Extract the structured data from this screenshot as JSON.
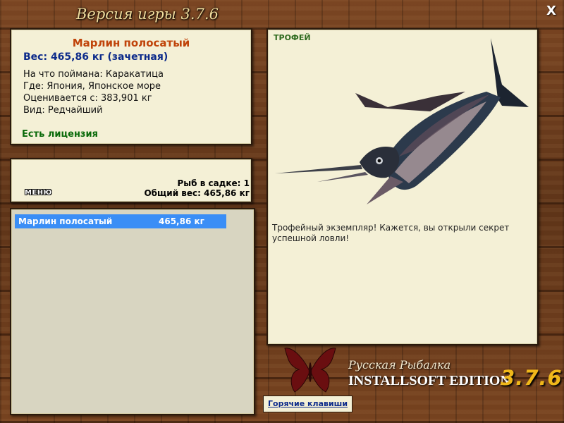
{
  "window": {
    "title": "Версия игры 3.7.6",
    "close_label": "X"
  },
  "fish_info": {
    "name": "Марлин полосатый",
    "weight": "Вес: 465,86 кг (зачетная)",
    "details": [
      "На что поймана: Каракатица",
      "Где: Япония, Японское море",
      "Оценивается с: 383,901 кг",
      "Вид: Редчайший"
    ],
    "license": "Есть лицензия"
  },
  "cage": {
    "menu_label": "МЕНЮ",
    "count": "Рыб в садке: 1",
    "total_weight": "Общий вес: 465,86 кг"
  },
  "catch_list": [
    {
      "name": "Марлин полосатый",
      "weight": "465,86 кг"
    }
  ],
  "trophy": {
    "label": "ТРОФЕЙ",
    "description": "Трофейный экземпляр! Кажется, вы открыли секрет успешной ловли!"
  },
  "branding": {
    "subtitle": "Русская Рыбалка",
    "edition": "INSTALLSOFT EDITION",
    "version": "3.7.6"
  },
  "footer": {
    "hotkeys_label": "Горячие клавиши"
  },
  "colors": {
    "panel_bg": "#f4f0d6",
    "fish_name": "#c0440a",
    "weight": "#0c2a8a",
    "license": "#0a6a0a",
    "selection": "#3a8ef6",
    "version_gold": "#f0b81a"
  },
  "icons": {
    "close": "close-icon",
    "logo": "butterfly-logo-icon",
    "trophy_image": "marlin-fish-image"
  }
}
